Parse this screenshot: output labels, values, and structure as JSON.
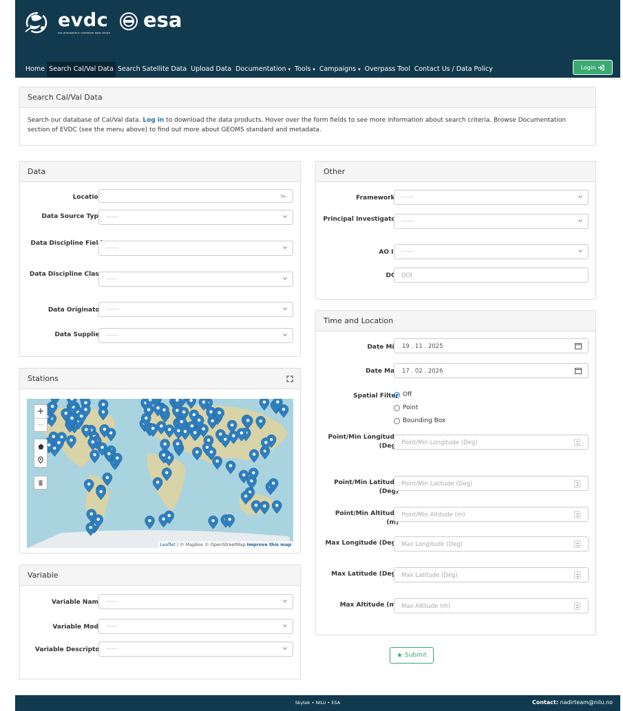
{
  "header": {
    "brand": "evdc",
    "brand_sub": "esa atmospheric validation data centre",
    "partner": "esa",
    "nav": [
      {
        "label": "Home",
        "caret": false,
        "active": false
      },
      {
        "label": "Search Cal/Val Data",
        "caret": false,
        "active": true
      },
      {
        "label": "Search Satellite Data",
        "caret": false,
        "active": false
      },
      {
        "label": "Upload Data",
        "caret": false,
        "active": false
      },
      {
        "label": "Documentation",
        "caret": true,
        "active": false
      },
      {
        "label": "Tools",
        "caret": true,
        "active": false
      },
      {
        "label": "Campaigns",
        "caret": true,
        "active": false
      },
      {
        "label": "Overpass Tool",
        "caret": false,
        "active": false
      },
      {
        "label": "Contact Us / Data Policy",
        "caret": false,
        "active": false
      }
    ],
    "login_label": "Login"
  },
  "intro": {
    "title": "Search Cal/Val Data",
    "text_before": "Search our database of Cal/Val data. ",
    "link": "Log in",
    "text_after": " to download the data products. Hover over the form fields to see more information about search criteria. Browse Documentation section of EVDC (see the menu above) to find out more about GEOMS standard and metadata."
  },
  "data_panel": {
    "title": "Data",
    "location_label": "Location",
    "location_clear": "×",
    "fields": [
      {
        "label": "Data Source Type",
        "placeholder": "-------"
      },
      {
        "label": "Data Discipline Field",
        "placeholder": "-------"
      },
      {
        "label": "Data Discipline Class",
        "placeholder": "-------"
      },
      {
        "label": "Data Originator",
        "placeholder": "-------"
      },
      {
        "label": "Data Supplier",
        "placeholder": "-------"
      }
    ]
  },
  "stations_panel": {
    "title": "Stations",
    "zoom_in": "+",
    "zoom_out": "−",
    "attribution_leaflet": "Leaflet",
    "attribution_rest": " | © Mapbox © OpenStreetMap ",
    "attribution_improve": "Improve this map"
  },
  "variable_panel": {
    "title": "Variable",
    "fields": [
      {
        "label": "Variable Name",
        "placeholder": "-------"
      },
      {
        "label": "Variable Mode",
        "placeholder": "-------"
      },
      {
        "label": "Variable Descriptor",
        "placeholder": "-------"
      }
    ]
  },
  "other_panel": {
    "title": "Other",
    "fields": [
      {
        "label": "Frameworks",
        "placeholder": "-------"
      },
      {
        "label": "Principal Investigator",
        "placeholder": "-------"
      },
      {
        "label": "AO ID",
        "placeholder": "-------"
      }
    ],
    "doi_label": "DOI",
    "doi_placeholder": "DOI"
  },
  "time_panel": {
    "title": "Time and Location",
    "date_min_label": "Date Min",
    "date_min_value": "19 . 11 . 2025",
    "date_max_label": "Date Max",
    "date_max_value": "17 . 02 . 2026",
    "spatial_label": "Spatial Filter",
    "spatial_options": [
      "Off",
      "Point",
      "Bounding Box"
    ],
    "spatial_selected": "Off",
    "numeric_fields": [
      {
        "label": "Point/Min Longitude (Deg)",
        "placeholder": "Point/Min Longitude (Deg)"
      },
      {
        "label": "Point/Min Latitude (Deg)",
        "placeholder": "Point/Min Latitude (Deg)"
      },
      {
        "label": "Point/Min Altitude (m)",
        "placeholder": "Point/Min Altitude (m)"
      },
      {
        "label": "Max Longitude (Deg)",
        "placeholder": "Max Longitude (Deg)"
      },
      {
        "label": "Max Latitude (Deg)",
        "placeholder": "Max Latitude (Deg)"
      },
      {
        "label": "Max Altitude (m)",
        "placeholder": "Max Altitude (m)"
      }
    ]
  },
  "submit_label": "Submit",
  "footer": {
    "center": "Skytek • NILU • ESA",
    "contact_label": "Contact:",
    "contact_email": "nadirteam@nilu.no"
  },
  "colors": {
    "header_bg": "#123a4f",
    "accent_green": "#3aaa72",
    "marker_blue": "#2f7fc1",
    "ocean": "#a9d3df",
    "land": "#d9d3a8"
  }
}
